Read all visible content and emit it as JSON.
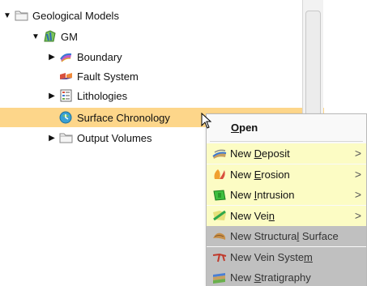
{
  "tree": {
    "root": {
      "label": "Geological Models"
    },
    "gm": {
      "label": "GM"
    },
    "boundary": {
      "label": "Boundary"
    },
    "fault_system": {
      "label": "Fault System"
    },
    "lithologies": {
      "label": "Lithologies"
    },
    "surface_chronology": {
      "label": "Surface Chronology"
    },
    "output_volumes": {
      "label": "Output Volumes"
    }
  },
  "context_menu": {
    "open": {
      "label": "Open",
      "mnemonic": "O"
    },
    "items": [
      {
        "pre": "New ",
        "mn": "D",
        "post": "eposit",
        "submenu": true,
        "state": "enabled",
        "icon": "deposit-icon"
      },
      {
        "pre": "New ",
        "mn": "E",
        "post": "rosion",
        "submenu": true,
        "state": "enabled",
        "icon": "erosion-icon"
      },
      {
        "pre": "New ",
        "mn": "I",
        "post": "ntrusion",
        "submenu": true,
        "state": "enabled",
        "icon": "intrusion-icon"
      },
      {
        "pre": "New Vei",
        "mn": "n",
        "post": "",
        "submenu": true,
        "state": "enabled",
        "icon": "vein-icon"
      },
      {
        "pre": "New Structura",
        "mn": "l",
        "post": " Surface",
        "submenu": false,
        "state": "disabled",
        "icon": "structural-surface-icon"
      },
      {
        "pre": "New Vein Syste",
        "mn": "m",
        "post": "",
        "submenu": false,
        "state": "disabled",
        "icon": "vein-system-icon"
      },
      {
        "pre": "New ",
        "mn": "S",
        "post": "tratigraphy",
        "submenu": false,
        "state": "disabled",
        "icon": "stratigraphy-icon"
      }
    ],
    "submenu_arrow": ">"
  },
  "colors": {
    "selection": "#fdd68a",
    "menu_enabled_bg": "#fcfcc4",
    "menu_disabled_bg": "#c0c0c0"
  }
}
